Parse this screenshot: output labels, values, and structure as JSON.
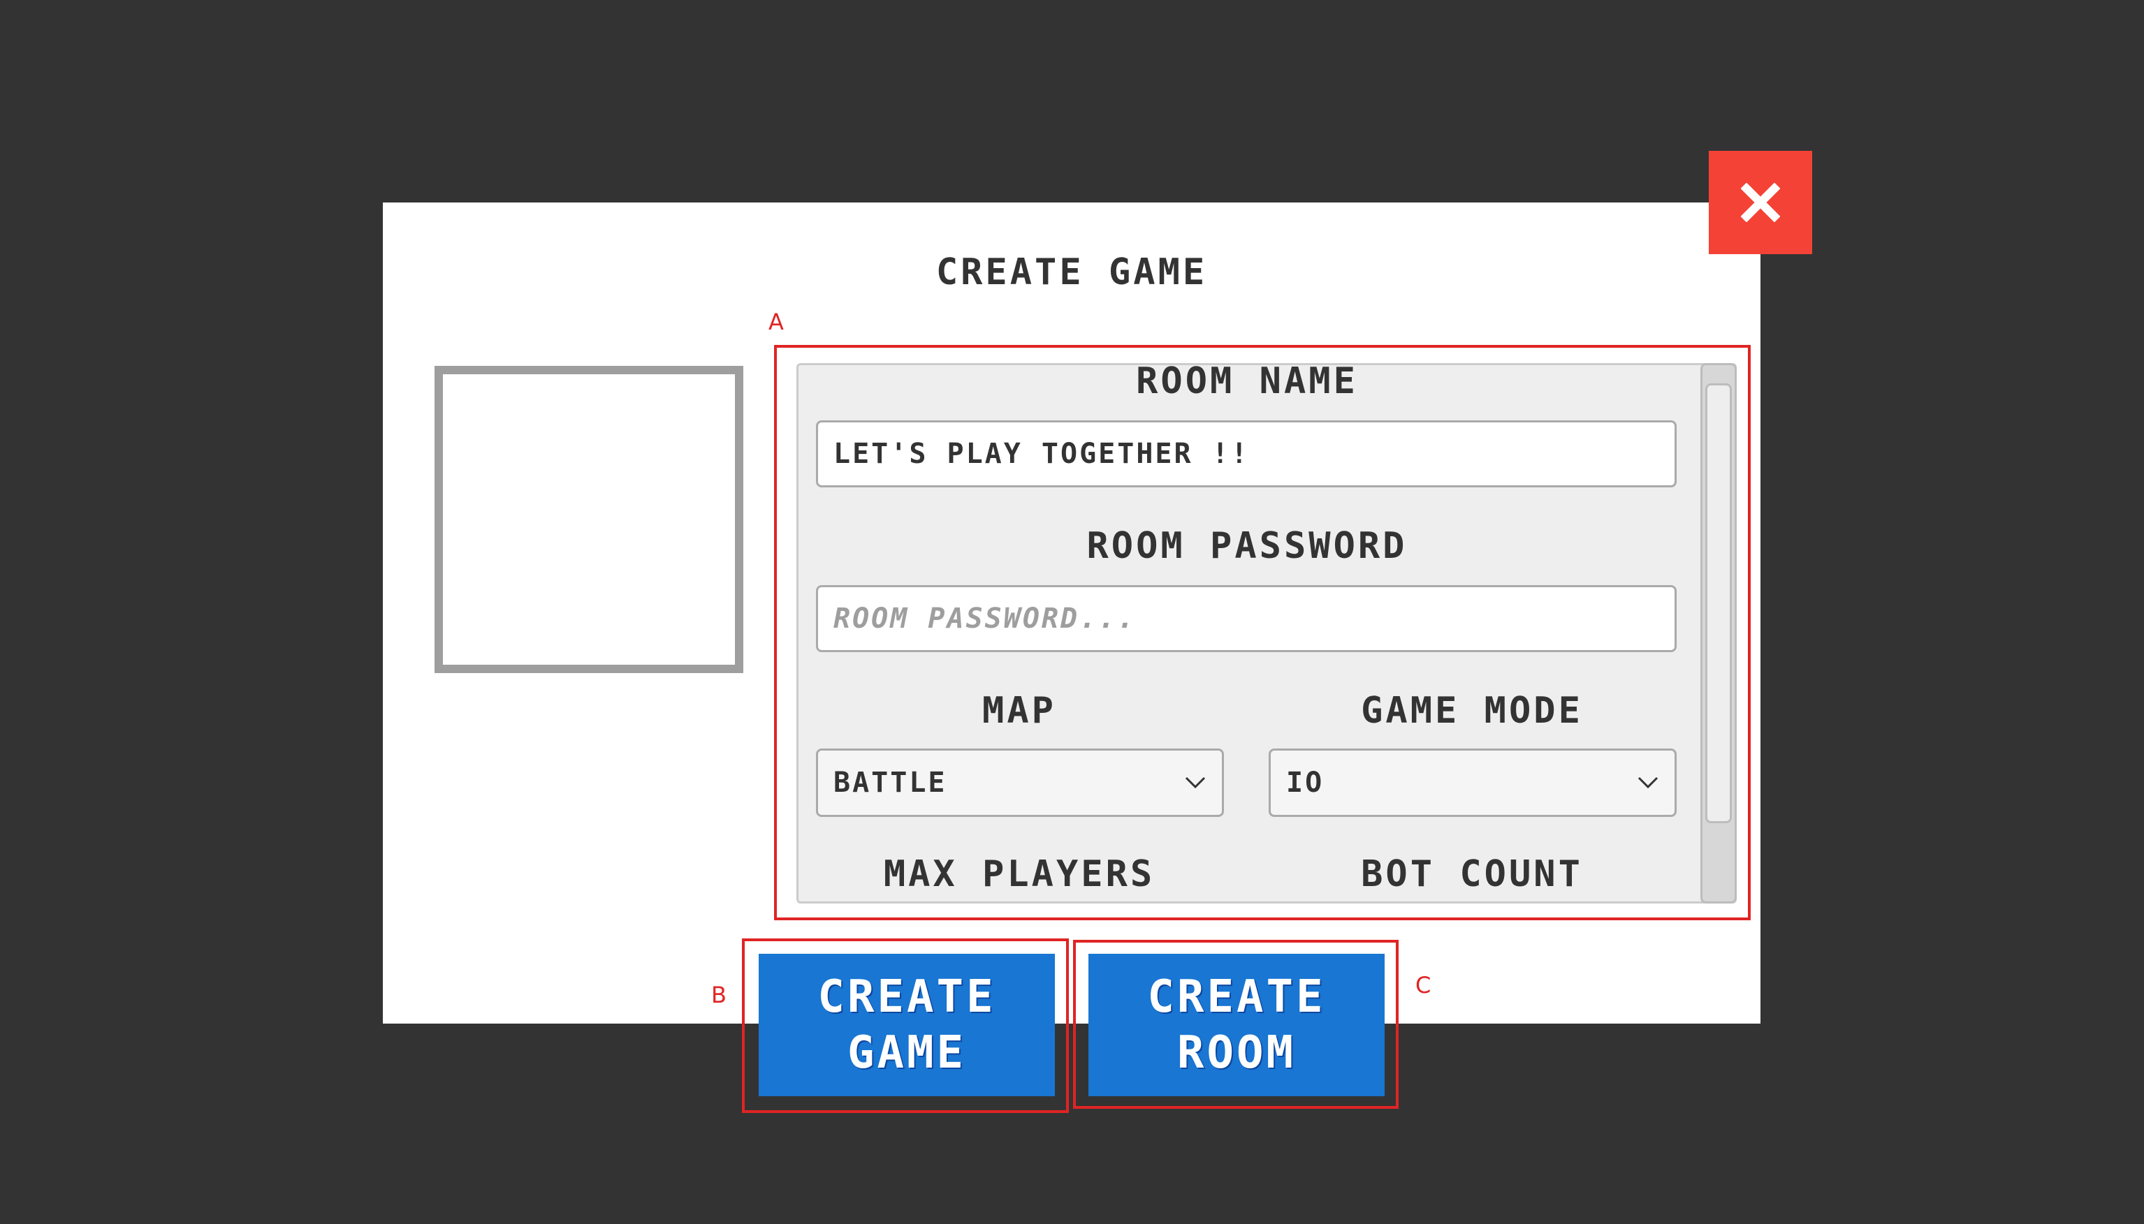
{
  "dialog": {
    "title": "CREATE GAME"
  },
  "form": {
    "room_name_label": "ROOM NAME",
    "room_name_value": "LET'S PLAY TOGETHER !!",
    "room_password_label": "ROOM PASSWORD",
    "room_password_placeholder": "ROOM PASSWORD...",
    "map_label": "MAP",
    "map_value": "BATTLE",
    "game_mode_label": "GAME MODE",
    "game_mode_value": "IO",
    "max_players_label": "MAX PLAYERS",
    "bot_count_label": "BOT COUNT"
  },
  "buttons": {
    "create_game_line1": "CREATE",
    "create_game_line2": "GAME",
    "create_room_line1": "CREATE",
    "create_room_line2": "ROOM"
  },
  "annotations": {
    "a": "A",
    "b": "B",
    "c": "C"
  },
  "colors": {
    "backdrop": "#333333",
    "close_button": "#f44336",
    "action_button": "#1976d2",
    "annotation": "#e02424"
  },
  "icons": {
    "close": "close-icon",
    "select_chevron": "chevron-down-icon"
  }
}
